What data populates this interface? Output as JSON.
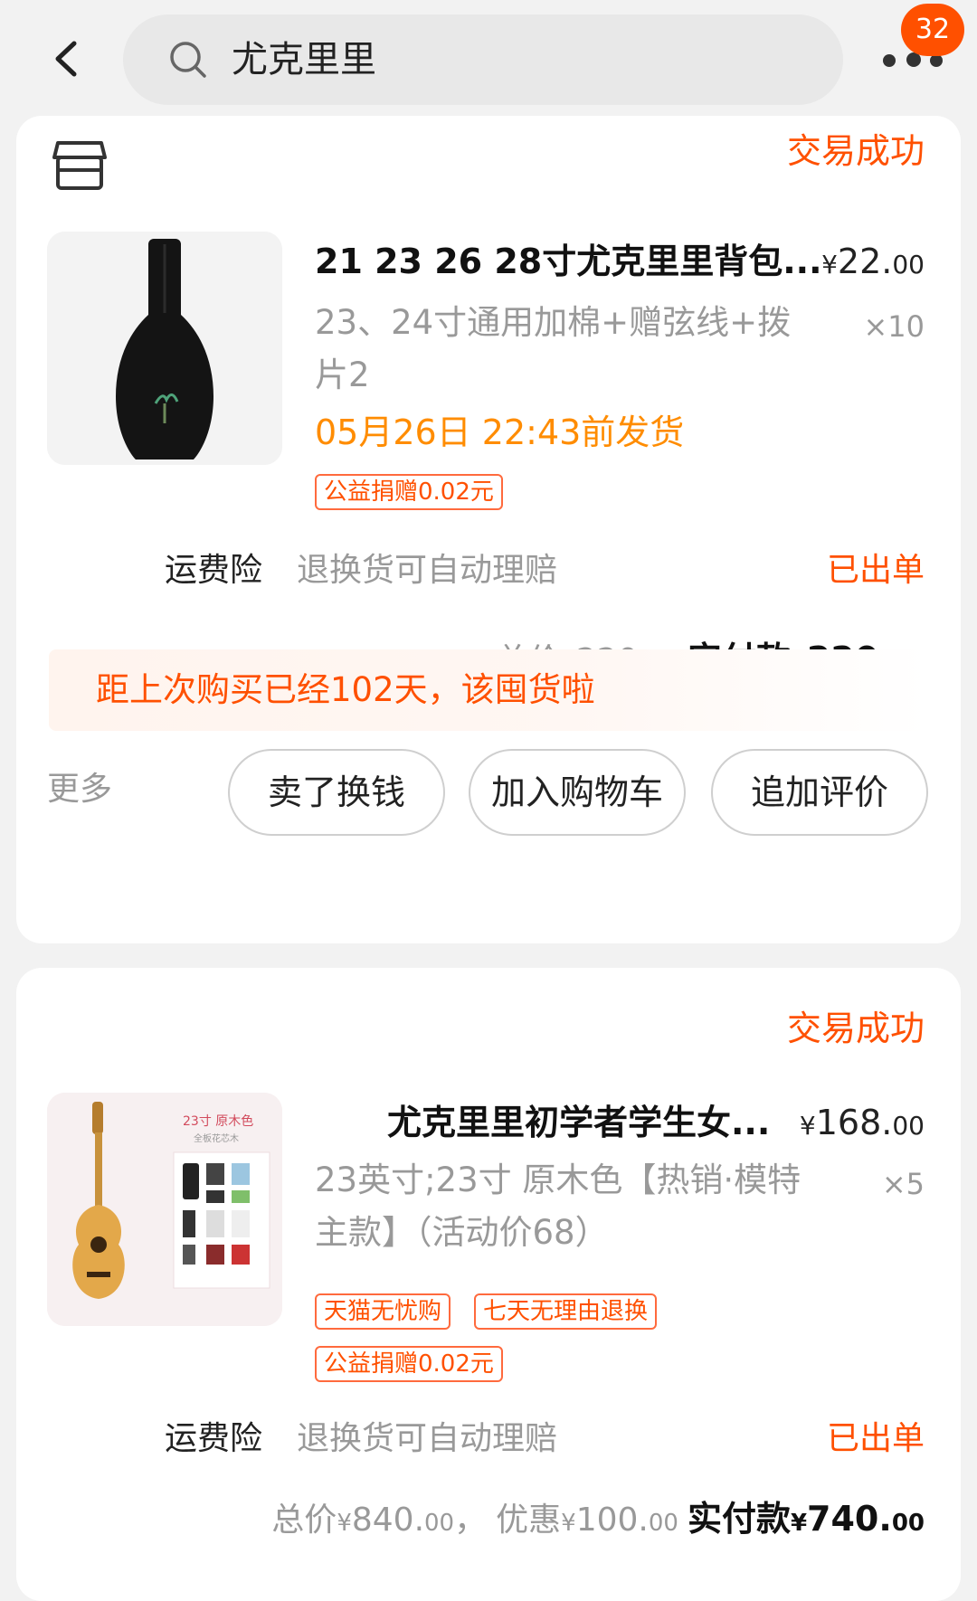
{
  "header": {
    "search_query": "尤克里里",
    "message_badge": "32"
  },
  "orders": [
    {
      "status": "交易成功",
      "title": "21 23 26 28寸尤克里里背包...",
      "price_symbol": "¥",
      "price_int": "22.",
      "price_dec": "00",
      "sku": "23、24寸通用加棉+赠弦线+拨片2",
      "quantity": "×10",
      "ship_time": "05月26日 22:43前发货",
      "tags": [
        "公益捐赠0.02元"
      ],
      "insurance_label": "运费险",
      "insurance_desc": "退换货可自动理赔",
      "insurance_status": "已出单",
      "total_label": "总价",
      "total_int": "220.",
      "total_dec": "00",
      "paid_label": "实付款",
      "paid_int": "220.",
      "paid_dec": "00",
      "notice": "距上次购买已经102天，该囤货啦",
      "more_label": "更多",
      "actions": [
        "卖了换钱",
        "加入购物车",
        "追加评价"
      ]
    },
    {
      "status": "交易成功",
      "title": "尤克里里初学者学生女...",
      "price_symbol": "¥",
      "price_int": "168.",
      "price_dec": "00",
      "sku": "23英寸;23寸 原木色【热销·模特主款】（活动价68）",
      "quantity": "×5",
      "tags": [
        "天猫无忧购",
        "七天无理由退换",
        "公益捐赠0.02元"
      ],
      "insurance_label": "运费险",
      "insurance_desc": "退换货可自动理赔",
      "insurance_status": "已出单",
      "total_label": "总价",
      "total_int": "840.",
      "total_dec": "00",
      "discount_label": "优惠",
      "discount_int": "100.",
      "discount_dec": "00",
      "paid_label": "实付款",
      "paid_int": "740.",
      "paid_dec": "00",
      "image_text_1": "23寸 原木色",
      "image_text_2": "全板花芯木"
    }
  ],
  "colors": {
    "accent": "#ff5000",
    "ship_orange": "#ff8c00",
    "muted": "#999999"
  }
}
